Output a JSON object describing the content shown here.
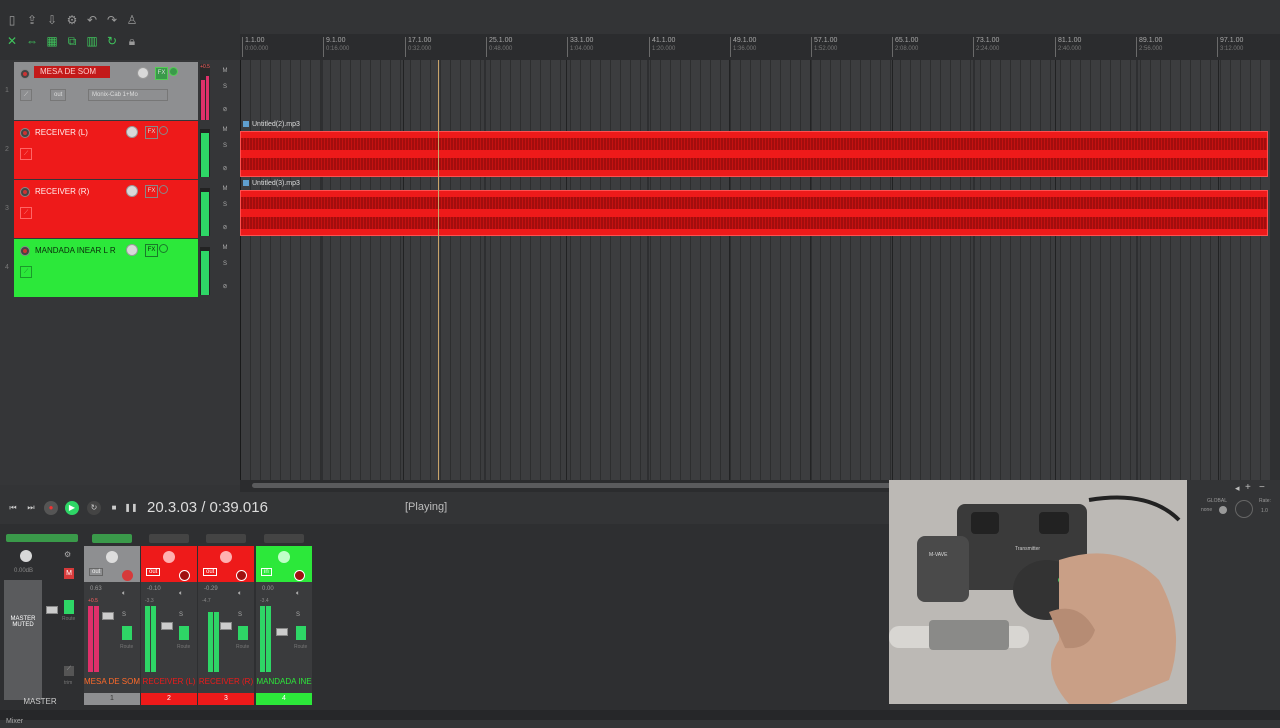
{
  "ruler": {
    "marks": [
      {
        "main": "1.1.00",
        "sub": "0:00.000"
      },
      {
        "main": "9.1.00",
        "sub": "0:16.000"
      },
      {
        "main": "17.1.00",
        "sub": "0:32.000"
      },
      {
        "main": "25.1.00",
        "sub": "0:48.000"
      },
      {
        "main": "33.1.00",
        "sub": "1:04.000"
      },
      {
        "main": "41.1.00",
        "sub": "1:20.000"
      },
      {
        "main": "49.1.00",
        "sub": "1:36.000"
      },
      {
        "main": "57.1.00",
        "sub": "1:52.000"
      },
      {
        "main": "65.1.00",
        "sub": "2:08.000"
      },
      {
        "main": "73.1.00",
        "sub": "2:24.000"
      },
      {
        "main": "81.1.00",
        "sub": "2:40.000"
      },
      {
        "main": "89.1.00",
        "sub": "2:56.000"
      },
      {
        "main": "97.1.00",
        "sub": "3:12.000"
      }
    ]
  },
  "tracks": [
    {
      "num": "1",
      "name": "MESA DE SOM",
      "fx": "FX",
      "route": "out",
      "send": "Monix-Cab 1+Mo",
      "color": "#8e8f91",
      "meter_peak": "+0.5"
    },
    {
      "num": "2",
      "name": "RECEIVER (L)",
      "fx": "FX",
      "route": "out",
      "color": "#ee1a1a"
    },
    {
      "num": "3",
      "name": "RECEIVER (R)",
      "fx": "FX",
      "route": "out",
      "color": "#ee1a1a"
    },
    {
      "num": "4",
      "name": "MANDADA INEAR L R",
      "fx": "FX",
      "route": "out",
      "color": "#2ce83a"
    }
  ],
  "items": [
    {
      "label": "Untitled(2).mp3"
    },
    {
      "label": "Untitled(3).mp3"
    }
  ],
  "transport": {
    "time": "20.3.03 / 0:39.016",
    "status": "[Playing]"
  },
  "mixer": {
    "master": {
      "label": "MASTER",
      "muted_text": "MASTER\nMUTED",
      "vol": "0.00dB",
      "m": "M"
    },
    "strips": [
      {
        "name": "MESA DE SOM",
        "num": "1",
        "color": "#8e8f91",
        "vol": "0.63",
        "peak": "+0.5",
        "route": "out",
        "name_color": "#ff6a2a"
      },
      {
        "name": "RECEIVER (L)",
        "num": "2",
        "color": "#ee1a1a",
        "vol": "-0.10",
        "peak": "-3.3",
        "route": "out",
        "name_color": "#ee1a1a"
      },
      {
        "name": "RECEIVER (R)",
        "num": "3",
        "color": "#ee1a1a",
        "vol": "-0.29",
        "peak": "-4.7",
        "route": "out",
        "name_color": "#ee1a1a"
      },
      {
        "name": "MANDADA INE",
        "num": "4",
        "color": "#2ce83a",
        "vol": "0.00",
        "peak": "-3.4",
        "route": "in",
        "name_color": "#2ce83a"
      }
    ],
    "route_label": "Route",
    "trim_label": "trim"
  },
  "bottom_tab": "Mixer",
  "right_panel": {
    "global": "GLOBAL",
    "none": "none",
    "rate": "Rate:",
    "rate_val": "1.0"
  },
  "video": {
    "device_label": "M-VAVE",
    "transmitter_label": "Transmitter"
  }
}
